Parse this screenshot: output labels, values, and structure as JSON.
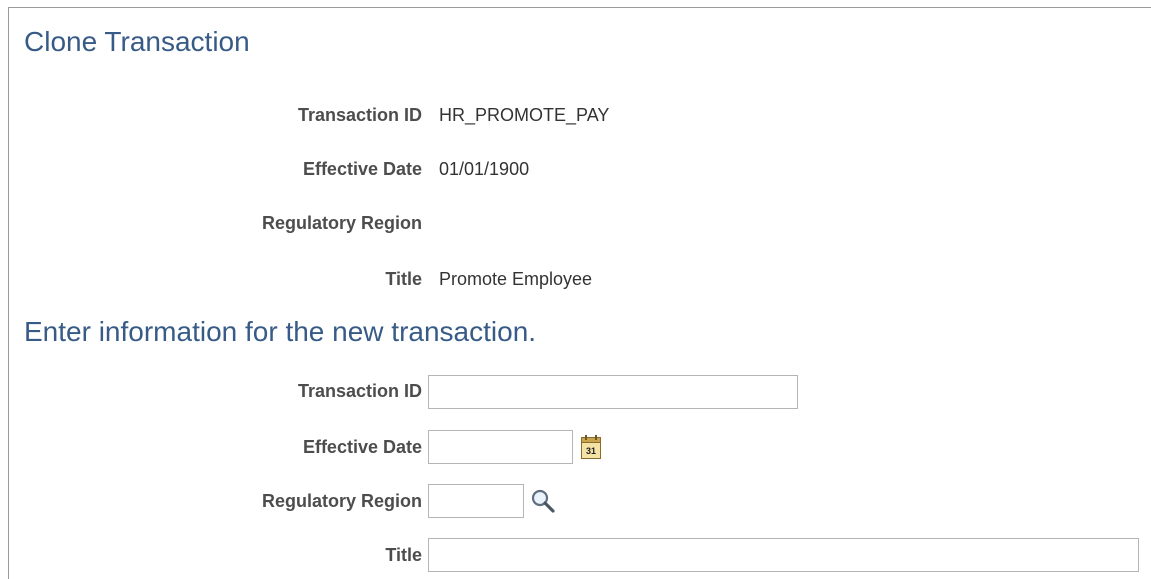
{
  "page": {
    "title": "Clone Transaction",
    "section_title": "Enter information for the new transaction."
  },
  "existing": {
    "transaction_id": {
      "label": "Transaction ID",
      "value": "HR_PROMOTE_PAY"
    },
    "effective_date": {
      "label": "Effective Date",
      "value": "01/01/1900"
    },
    "regulatory_region": {
      "label": "Regulatory Region",
      "value": ""
    },
    "title": {
      "label": "Title",
      "value": "Promote Employee"
    }
  },
  "new": {
    "transaction_id": {
      "label": "Transaction ID",
      "value": ""
    },
    "effective_date": {
      "label": "Effective Date",
      "value": ""
    },
    "regulatory_region": {
      "label": "Regulatory Region",
      "value": ""
    },
    "title": {
      "label": "Title",
      "value": ""
    }
  },
  "icons": {
    "calendar": "calendar-icon",
    "search": "search-icon"
  },
  "colors": {
    "heading": "#375b86",
    "label": "#4d4d4d",
    "input_border": "#b5b5b5"
  }
}
